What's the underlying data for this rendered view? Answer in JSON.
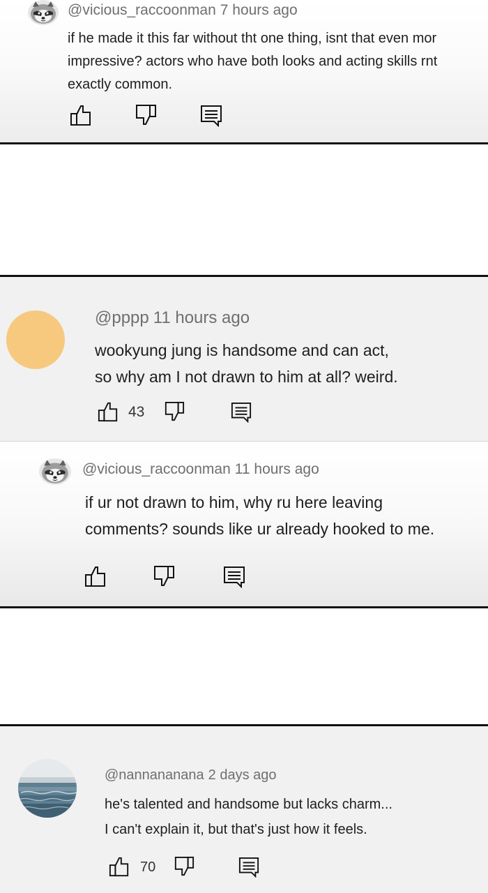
{
  "comments": [
    {
      "username": "@vicious_raccoonman",
      "time": "7 hours ago",
      "lines": [
        "if he made it this far without tht one thing, isnt that even mor",
        "impressive? actors who have both looks and acting skills rnt",
        "exactly common."
      ],
      "avatar": "raccoon-avatar",
      "like_count": null
    },
    {
      "username": "@pppp",
      "time": "11 hours ago",
      "lines": [
        "wookyung jung is handsome and can act,",
        "so why am I not drawn to him at all? weird."
      ],
      "avatar": "orange-circle-avatar",
      "avatar_color": "#f6c97e",
      "like_count": "43"
    },
    {
      "username": "@vicious_raccoonman",
      "time": "11 hours ago",
      "lines": [
        "if ur not drawn to him, why ru here leaving",
        "comments? sounds like ur already hooked to me."
      ],
      "avatar": "raccoon-avatar",
      "like_count": null
    },
    {
      "username": "@nannananana",
      "time": "2 days ago",
      "lines": [
        "he's talented and handsome but lacks charm...",
        "I can't explain it, but that's just how it feels."
      ],
      "avatar": "ocean-avatar",
      "like_count": "70"
    }
  ],
  "icons": {
    "like": "thumbs-up-icon",
    "dislike": "thumbs-down-icon",
    "reply": "reply-comment-icon"
  },
  "colors": {
    "panel_border": "#111111",
    "meta_text": "#6f6f6f",
    "body_text": "#1e1e1e"
  }
}
